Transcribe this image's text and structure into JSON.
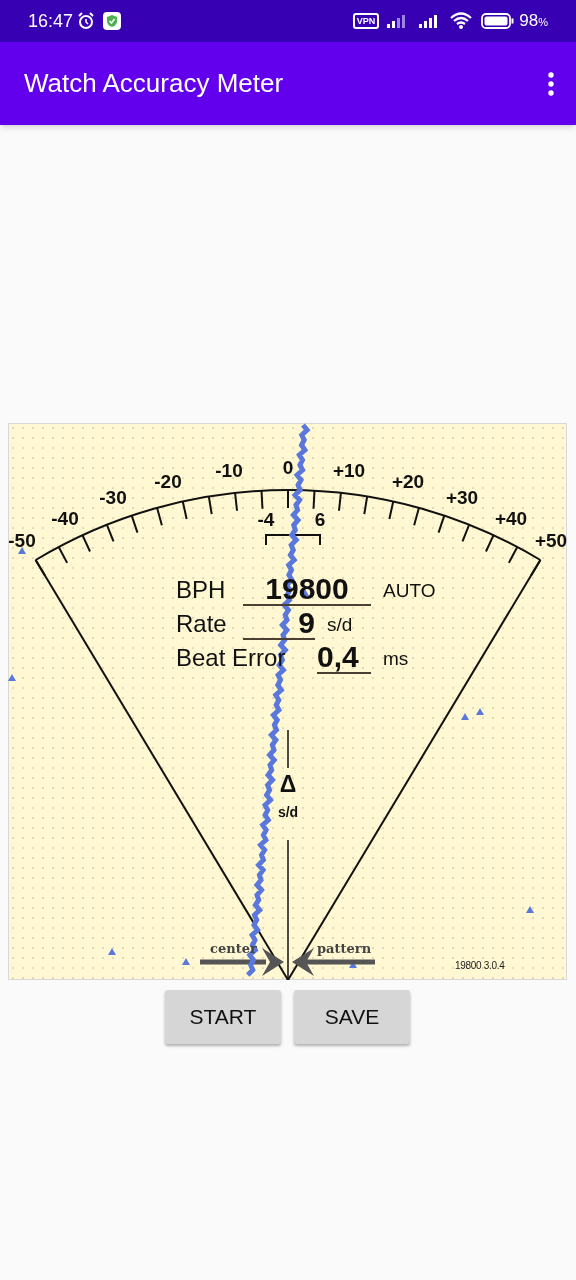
{
  "status_bar": {
    "time": "16:47",
    "vpn": "VPN",
    "battery": "98",
    "battery_unit": "%"
  },
  "app_bar": {
    "title": "Watch Accuracy Meter"
  },
  "meter": {
    "scale_labels": [
      "-50",
      "-40",
      "-30",
      "-20",
      "-10",
      "0",
      "+10",
      "+20",
      "+30",
      "+40",
      "+50"
    ],
    "range_labels": [
      "-4",
      "6"
    ],
    "readings": [
      {
        "label": "BPH",
        "value": "19800",
        "unit": "AUTO"
      },
      {
        "label": "Rate",
        "value": "9",
        "unit": "s/d"
      },
      {
        "label": "Beat Error",
        "value": "0,4",
        "unit": "ms"
      }
    ],
    "delta": {
      "symbol": "Δ",
      "unit": "s/d"
    },
    "center_label": "center",
    "pattern_label": "pattern",
    "version": "19800 3.0.4"
  },
  "buttons": [
    "START",
    "SAVE"
  ]
}
